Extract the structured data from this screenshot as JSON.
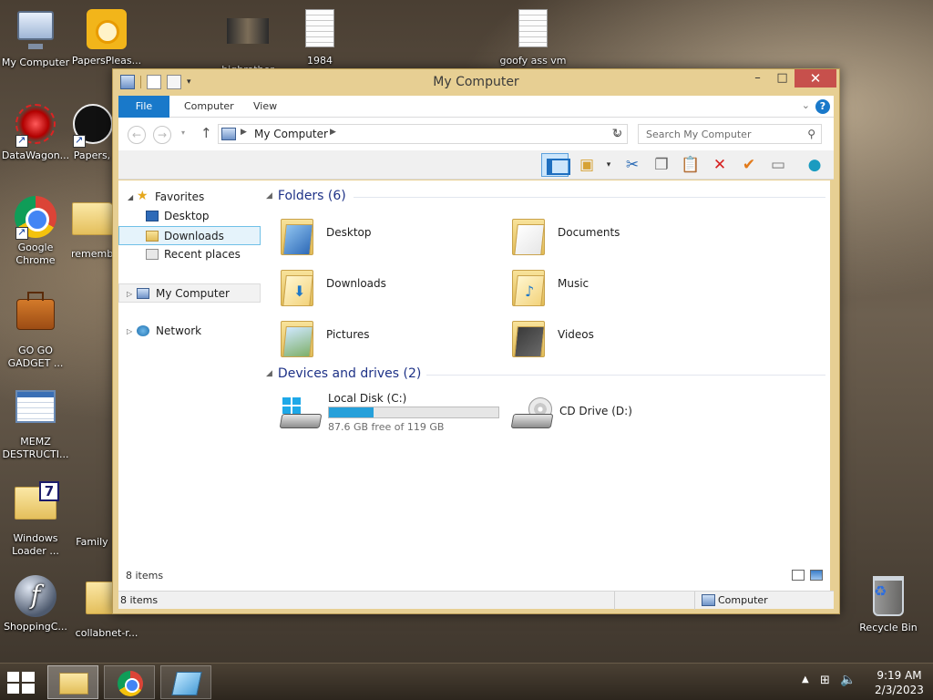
{
  "desktop": {
    "icons": [
      {
        "label": "My Computer"
      },
      {
        "label": "PapersPleas..."
      },
      {
        "label": "bigbrother"
      },
      {
        "label": "1984"
      },
      {
        "label": "goofy ass vm"
      },
      {
        "label": "DataWagon..."
      },
      {
        "label": "Papers,"
      },
      {
        "label": "Google Chrome"
      },
      {
        "label": "rememb"
      },
      {
        "label": "GO GO GADGET ..."
      },
      {
        "label": "MEMZ DESTRUCTI..."
      },
      {
        "label": "Windows Loader ..."
      },
      {
        "label": "Family"
      },
      {
        "label": "ShoppingC..."
      },
      {
        "label": "collabnet-r..."
      },
      {
        "label": "Recycle Bin"
      }
    ]
  },
  "window": {
    "title": "My Computer",
    "ribbon_tabs": [
      "File",
      "Computer",
      "View"
    ],
    "address": {
      "location": "My Computer"
    },
    "search": {
      "placeholder": "Search My Computer"
    },
    "nav_pane": {
      "favorites": "Favorites",
      "desktop": "Desktop",
      "downloads": "Downloads",
      "recent_places": "Recent places",
      "my_computer": "My Computer",
      "network": "Network"
    },
    "groups": {
      "folders_header": "Folders (6)",
      "devices_header": "Devices and drives (2)"
    },
    "folders": [
      {
        "name": "Desktop"
      },
      {
        "name": "Documents"
      },
      {
        "name": "Downloads"
      },
      {
        "name": "Music"
      },
      {
        "name": "Pictures"
      },
      {
        "name": "Videos"
      }
    ],
    "drives": [
      {
        "name": "Local Disk (C:)",
        "free_text": "87.6 GB free of 119 GB",
        "used_fraction": 0.264
      },
      {
        "name": "CD Drive (D:)"
      }
    ],
    "items_count": "8 items",
    "statusbar": {
      "count": "8 items",
      "location": "Computer"
    }
  },
  "taskbar": {
    "time": "9:19 AM",
    "date": "2/3/2023"
  }
}
